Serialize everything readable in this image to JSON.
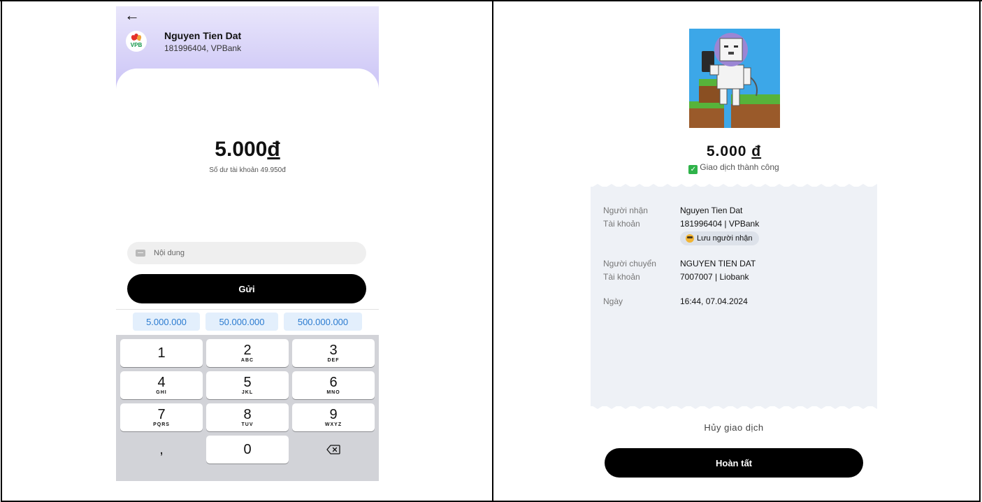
{
  "left": {
    "recipient_name": "Nguyen Tien Dat",
    "recipient_account": "181996404, VPBank",
    "bank_logo_text": "VPB",
    "amount": "5.000",
    "currency_symbol": "đ",
    "balance_text": "Số dư tài khoản 49.950đ",
    "note_placeholder": "Nội dung",
    "send_label": "Gửi",
    "suggestions": [
      "5.000.000",
      "50.000.000",
      "500.000.000"
    ],
    "keys": [
      {
        "digit": "1",
        "letters": ""
      },
      {
        "digit": "2",
        "letters": "ABC"
      },
      {
        "digit": "3",
        "letters": "DEF"
      },
      {
        "digit": "4",
        "letters": "GHI"
      },
      {
        "digit": "5",
        "letters": "JKL"
      },
      {
        "digit": "6",
        "letters": "MNO"
      },
      {
        "digit": "7",
        "letters": "PQRS"
      },
      {
        "digit": "8",
        "letters": "TUV"
      },
      {
        "digit": "9",
        "letters": "WXYZ"
      },
      {
        "digit": ",",
        "letters": ""
      },
      {
        "digit": "0",
        "letters": ""
      },
      {
        "digit": "⌫",
        "letters": ""
      }
    ],
    "icons": {
      "back": "arrow-left-icon",
      "note": "message-icon",
      "delete": "backspace-icon"
    }
  },
  "right": {
    "amount": "5.000",
    "currency_symbol": "đ",
    "status": "Giao dịch thành công",
    "receiver_label": "Người nhận",
    "receiver_name": "Nguyen Tien Dat",
    "receiver_account_label": "Tài khoản",
    "receiver_account": "181996404 | VPBank",
    "save_recipient_label": "Lưu người nhận",
    "sender_label": "Người chuyển",
    "sender_name": "NGUYEN TIEN DAT",
    "sender_account_label": "Tài khoản",
    "sender_account": "7007007 | Liobank",
    "date_label": "Ngày",
    "date_value": "16:44, 07.04.2024",
    "cancel_label": "Hủy giao dịch",
    "done_label": "Hoàn tất",
    "icons": {
      "status": "check-icon",
      "save": "smile-icon"
    }
  },
  "colors": {
    "header_gradient_start": "#e9e6fb",
    "header_gradient_end": "#cbc4f6",
    "chip_bg": "#e3effc",
    "chip_text": "#2b7bd0",
    "receipt_bg": "#eef1f6",
    "success": "#2fb34a"
  }
}
